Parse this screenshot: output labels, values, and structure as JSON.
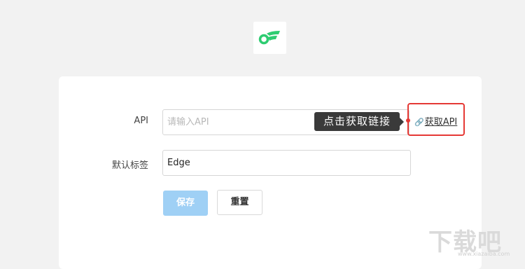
{
  "logo": {
    "name": "app-logo",
    "color": "#2ecc71"
  },
  "form": {
    "api": {
      "label": "API",
      "placeholder": "请输入API",
      "value": ""
    },
    "tag": {
      "label": "默认标签",
      "value": "Edge"
    },
    "get_api_link": "获取API",
    "tooltip": "点击获取链接"
  },
  "buttons": {
    "save": "保存",
    "reset": "重置"
  },
  "watermark": {
    "text": "下载吧",
    "url": "www.xiazaiba.com"
  }
}
